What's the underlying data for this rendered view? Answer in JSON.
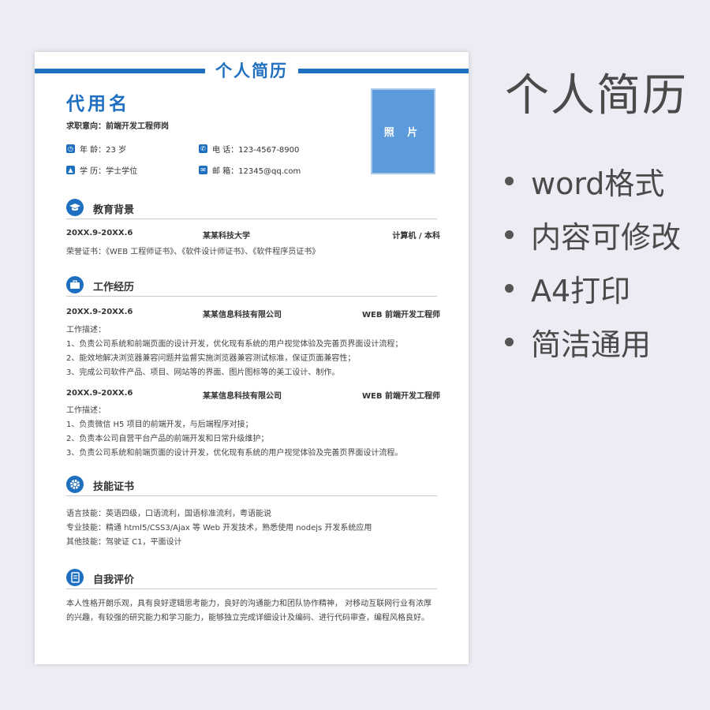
{
  "resume": {
    "title": "个人简历",
    "name": "代用名",
    "intent": "求职意向：前端开发工程师岗",
    "photo_label": "照 片",
    "info": {
      "age": "年 龄：23 岁",
      "phone": "电 话：123-4567-8900",
      "education": "学 历：学士学位",
      "email": "邮 箱：12345@qq.com"
    },
    "education": {
      "heading": "教育背景",
      "period": "20XX.9-20XX.6",
      "school": "某某科技大学",
      "major": "计算机 / 本科",
      "honors": "荣誉证书：《WEB 工程师证书》、《软件设计师证书》、《软件程序员证书》"
    },
    "work": {
      "heading": "工作经历",
      "jobs": [
        {
          "period": "20XX.9-20XX.6",
          "company": "某某信息科技有限公司",
          "role": "WEB 前端开发工程师",
          "desc_label": "工作描述：",
          "items": [
            "1、负责公司系统和前端页面的设计开发，优化现有系统的用户视觉体验及完善页界面设计流程；",
            "2、能效地解决浏览器兼容问题并监督实施浏览器兼容测试标准，保证页面兼容性；",
            "3、完成公司软件产品、项目、网站等的界面、图片图标等的美工设计、制作。"
          ]
        },
        {
          "period": "20XX.9-20XX.6",
          "company": "某某信息科技有限公司",
          "role": "WEB 前端开发工程师",
          "desc_label": "工作描述：",
          "items": [
            "1、负责微信 H5 项目的前端开发，与后端程序对接；",
            "2、负责本公司自营平台产品的前端开发和日常升级维护；",
            "3、负责公司系统和前端页面的设计开发，优化现有系统的用户视觉体验及完善页界面设计流程。"
          ]
        }
      ]
    },
    "skills": {
      "heading": "技能证书",
      "items": [
        "语言技能：英语四级，口语流利，国语标准流利，粤语能说",
        "专业技能：精通 html5/CSS3/Ajax 等 Web 开发技术，熟悉使用 nodejs 开发系统应用",
        "其他技能：驾驶证 C1，平面设计"
      ]
    },
    "self": {
      "heading": "自我评价",
      "text": "本人性格开朗乐观，具有良好逻辑思考能力，良好的沟通能力和团队协作精神， 对移动互联网行业有浓厚的兴趣，有较强的研究能力和学习能力，能够独立完成详细设计及编码、进行代码审查，编程风格良好。"
    }
  },
  "side": {
    "title": "个人简历",
    "bullets": [
      "word格式",
      "内容可修改",
      "A4打印",
      "简洁通用"
    ]
  },
  "colors": {
    "accent": "#1f6fc0",
    "photo": "#5b9bdb",
    "background": "#ecedf4"
  }
}
